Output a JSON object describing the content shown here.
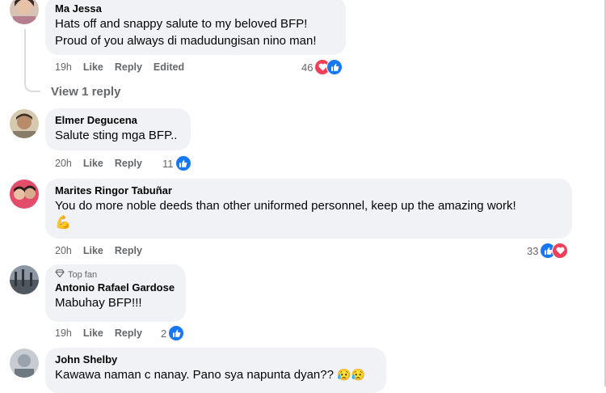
{
  "comments": [
    {
      "name": "Ma Jessa",
      "lines": [
        "Hats off and snappy salute to my beloved BFP!",
        "Proud of you always di madudungisan nino man!"
      ],
      "time": "19h",
      "like": "Like",
      "reply": "Reply",
      "edited": "Edited",
      "reaction_count": "46",
      "reactions": [
        "love-icon",
        "like-icon"
      ]
    },
    {
      "name": "Elmer Degucena",
      "lines": [
        "Salute sting mga BFP.."
      ],
      "time": "20h",
      "like": "Like",
      "reply": "Reply",
      "reaction_count": "11",
      "reactions": [
        "like-icon"
      ]
    },
    {
      "name": "Marites Ringor Tabuñar",
      "lines": [
        "You do more noble deeds than other uniformed personnel, keep up the amazing work!"
      ],
      "emoji": "💪",
      "time": "20h",
      "like": "Like",
      "reply": "Reply",
      "reaction_count": "33",
      "reactions": [
        "like-icon",
        "love-icon"
      ]
    },
    {
      "badge": "Top fan",
      "name": "Antonio Rafael Gardose",
      "lines": [
        "Mabuhay BFP!!!"
      ],
      "time": "19h",
      "like": "Like",
      "reply": "Reply",
      "reaction_count": "2",
      "reactions": [
        "like-icon"
      ]
    },
    {
      "name": "John Shelby",
      "lines": [
        "Kawawa naman c nanay. Pano sya napunta dyan??"
      ],
      "emoji_pair": "😥😥"
    }
  ],
  "view_replies": "View 1 reply",
  "colors": {
    "bubble": "#f0f2f5",
    "meta": "#65676b",
    "like": "#1877f2",
    "love": "#f33e58"
  }
}
